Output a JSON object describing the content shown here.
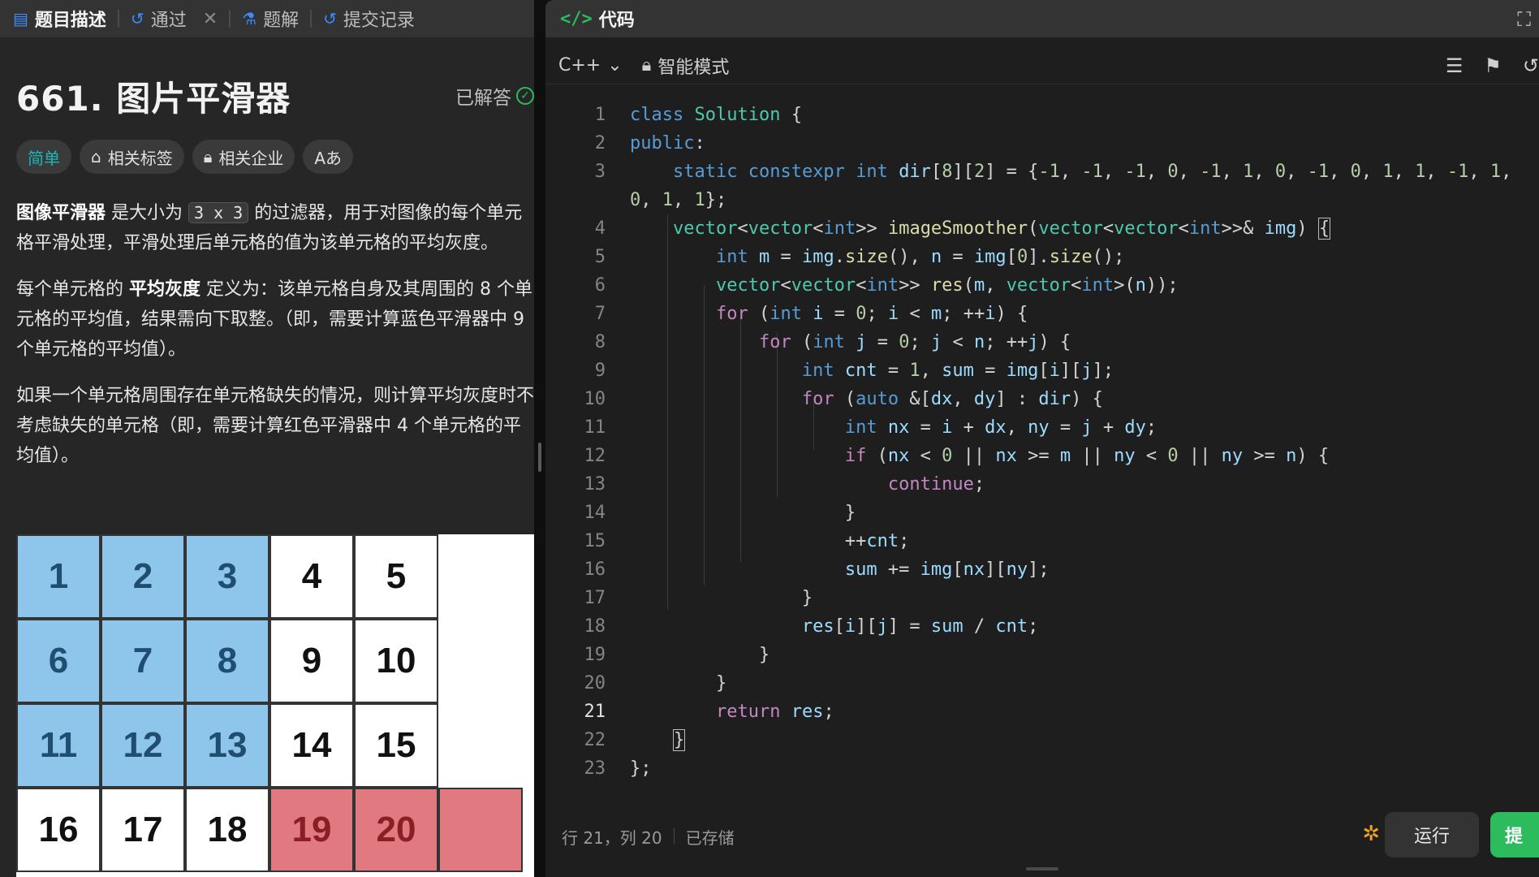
{
  "left": {
    "tabs": [
      {
        "label": "题目描述"
      },
      {
        "label": "通过"
      },
      {
        "label": "题解"
      },
      {
        "label": "提交记录"
      }
    ],
    "title": "661. 图片平滑器",
    "status": "已解答",
    "pills": {
      "difficulty": "简单",
      "tags": "相关标签",
      "companies": "相关企业",
      "translate": "Aあ"
    },
    "desc": {
      "p1_bold": "图像平滑器",
      "p1_a": " 是大小为 ",
      "p1_code": "3 x 3",
      "p1_b": " 的过滤器，用于对图像的每个单元格平滑处理，平滑处理后单元格的值为该单元格的平均灰度。",
      "p2_a": "每个单元格的 ",
      "p2_bold": "平均灰度",
      "p2_b": " 定义为：该单元格自身及其周围的 8 个单元格的平均值，结果需向下取整。（即，需要计算蓝色平滑器中 9 个单元格的平均值）。",
      "p3": "如果一个单元格周围存在单元格缺失的情况，则计算平均灰度时不考虑缺失的单元格（即，需要计算红色平滑器中 4 个单元格的平均值）。"
    },
    "grid": {
      "cells": [
        "1",
        "2",
        "3",
        "4",
        "5",
        "6",
        "7",
        "8",
        "9",
        "10",
        "11",
        "12",
        "13",
        "14",
        "15",
        "16",
        "17",
        "18",
        "19",
        "20"
      ]
    }
  },
  "right": {
    "header_title": "代码",
    "language": "C++",
    "mode": "智能模式",
    "line_numbers": [
      "1",
      "2",
      "3",
      "",
      "4",
      "5",
      "6",
      "7",
      "8",
      "9",
      "10",
      "11",
      "12",
      "13",
      "14",
      "15",
      "16",
      "17",
      "18",
      "19",
      "20",
      "21",
      "22",
      "23"
    ],
    "status": {
      "position": "行 21，列 20",
      "saved": "已存储"
    },
    "run_label": "运行",
    "submit_label": "提"
  },
  "colors": {
    "accent_green": "#2cbb5d",
    "easy_teal": "#1cb8b8",
    "blue_cell": "#8ec5ea",
    "red_cell": "#e07a80"
  }
}
